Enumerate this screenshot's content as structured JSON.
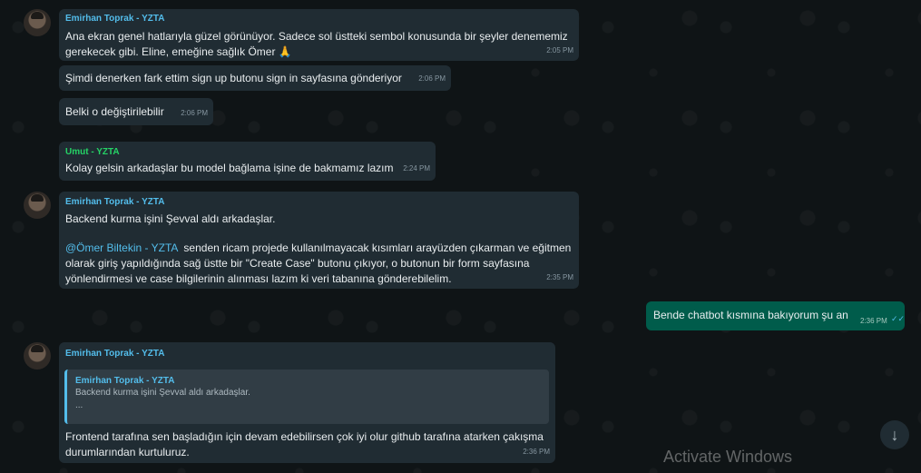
{
  "messages": [
    {
      "sender": "Emirhan Toprak - YZTA",
      "text": "Ana ekran genel hatlarıyla güzel görünüyor. Sadece sol üstteki sembol konusunda bir şeyler denememiz\ngerekecek gibi. Eline, emeğine sağlık Ömer 🙏",
      "time": "2:05 PM"
    },
    {
      "text": "Şimdi denerken fark ettim sign up butonu sign in sayfasına gönderiyor",
      "time": "2:06 PM"
    },
    {
      "text": "Belki o değiştirilebilir",
      "time": "2:06 PM"
    },
    {
      "sender": "Umut - YZTA",
      "text": "Kolay gelsin arkadaşlar bu model bağlama işine de bakmamız lazım",
      "time": "2:24 PM"
    },
    {
      "sender": "Emirhan Toprak - YZTA",
      "text_line1": "Backend kurma işini Şevval aldı arkadaşlar.",
      "mention": "@Ömer Biltekin - YZTA",
      "text_rest": "  senden ricam projede kullanılmayacak kısımları arayüzden çıkarman ve eğitmen\nolarak giriş yapıldığında sağ üstte bir \"Create Case\" butonu çıkıyor, o butonun bir form sayfasına\nyönlendirmesi ve case bilgilerinin alınması lazım ki veri tabanına gönderebilelim.",
      "time": "2:35 PM"
    },
    {
      "text": "Bende chatbot kısmına bakıyorum şu an",
      "time": "2:36 PM",
      "status": "✓✓"
    },
    {
      "sender": "Emirhan Toprak - YZTA",
      "quote_author": "Emirhan Toprak - YZTA",
      "quote_text": "Backend kurma işini Şevval aldı arkadaşlar.\n...",
      "text": "Frontend tarafına sen başladığın için devam edebilirsen çok iyi olur github tarafına atarken çakışma\ndurumlarından kurtuluruz.",
      "time": "2:36 PM"
    }
  ],
  "watermark": "Activate Windows",
  "scroll_icon": "↓"
}
